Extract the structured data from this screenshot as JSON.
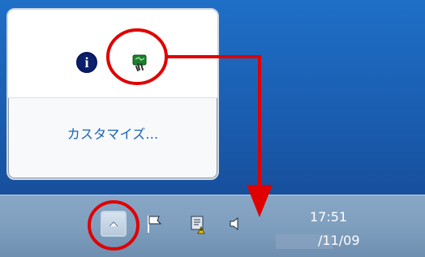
{
  "overflow_panel": {
    "customize_label": "カスタマイズ..."
  },
  "clock": {
    "time": "17:51",
    "date": "/11/09"
  },
  "colors": {
    "annotation_red": "#e00000",
    "taskbar": "#7f9fbf",
    "link": "#1b62b7"
  },
  "icons": {
    "info": "info-icon",
    "app": "green-app-icon",
    "show_hidden": "chevron-up-icon",
    "flag": "action-center-flag-icon",
    "network": "network-warning-icon",
    "volume": "speaker-icon"
  }
}
